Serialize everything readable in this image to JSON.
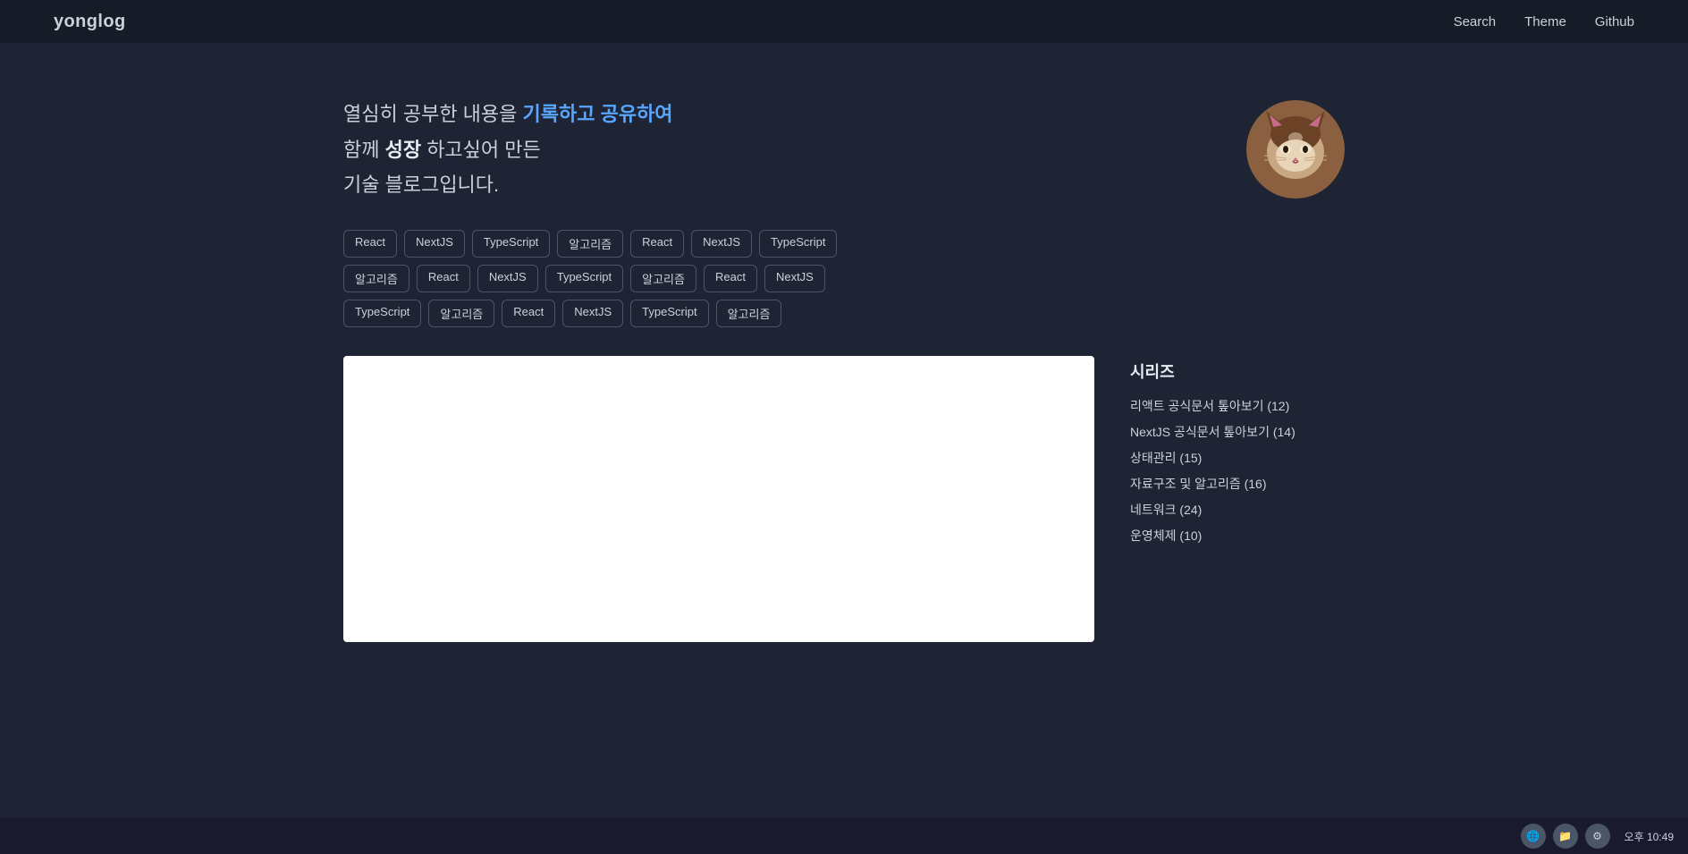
{
  "header": {
    "logo": "yonglog",
    "nav": [
      {
        "label": "Search",
        "href": "#"
      },
      {
        "label": "Theme",
        "href": "#"
      },
      {
        "label": "Github",
        "href": "#"
      }
    ]
  },
  "hero": {
    "text_line1_normal": "열심히 공부한 내용을 ",
    "text_line1_highlight": "기록하고 공유하여",
    "text_line2_normal": "함께 ",
    "text_line2_bold": "성장",
    "text_line2_normal2": " 하고싶어 만든",
    "text_line3": "기술 블로그입니다."
  },
  "tags": {
    "row1": [
      "React",
      "NextJS",
      "TypeScript",
      "알고리즘",
      "React",
      "NextJS",
      "TypeScript",
      "알고리즘",
      "React"
    ],
    "row2": [
      "NextJS",
      "TypeScript",
      "알고리즘",
      "React",
      "NextJS",
      "TypeScript",
      "알고리즘",
      "React",
      "NextJS"
    ],
    "row3": [
      "TypeScript",
      "알고리즘"
    ]
  },
  "sidebar": {
    "title": "시리즈",
    "series": [
      {
        "label": "리액트 공식문서 톺아보기 (12)"
      },
      {
        "label": "NextJS 공식문서 톺아보기 (14)"
      },
      {
        "label": "상태관리 (15)"
      },
      {
        "label": "자료구조 및 알고리즘 (16)"
      },
      {
        "label": "네트워크 (24)"
      },
      {
        "label": "운영체제 (10)"
      }
    ]
  },
  "taskbar": {
    "time": "오후 10:49"
  }
}
